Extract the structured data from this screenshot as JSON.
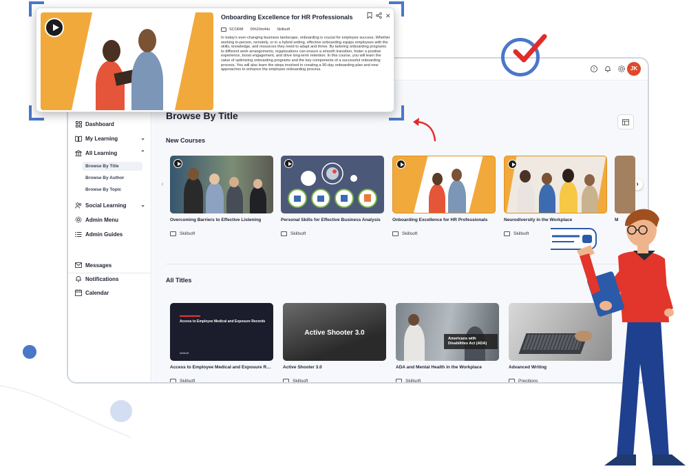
{
  "popup": {
    "title": "Onboarding Excellence for HR Professionals",
    "format": "SCORM",
    "duration": "00h20m44s",
    "provider": "Skillsoft",
    "description": "In today's ever-changing business landscape, onboarding is crucial for employee success. Whether working in-person, remotely, or in a hybrid setting, effective onboarding equips employees with the skills, knowledge, and resources they need to adapt and thrive. By tailoring onboarding programs to different work arrangements, organizations can ensure a smooth transition, foster a positive experience, boost engagement, and drive long-term retention. In this course, you will learn the value of optimizing onboarding programs and the key components of a successful onboarding process. You will also learn the steps involved in creating a 90-day onboarding plan and new approaches to enhance the employee onboarding process."
  },
  "topbar": {
    "avatar_initials": "JK"
  },
  "sidebar": {
    "items": [
      {
        "label": "Dashboard"
      },
      {
        "label": "My Learning"
      },
      {
        "label": "All Learning"
      },
      {
        "label": "Social Learning"
      },
      {
        "label": "Admin Menu"
      },
      {
        "label": "Admin Guides"
      }
    ],
    "sub_items": [
      {
        "label": "Browse By Title"
      },
      {
        "label": "Browse By Author"
      },
      {
        "label": "Browse By Topic"
      }
    ],
    "bottom_items": [
      {
        "label": "Messages"
      },
      {
        "label": "Notifications"
      },
      {
        "label": "Calendar"
      }
    ]
  },
  "main": {
    "page_title": "Browse By Title",
    "new_courses_title": "New Courses",
    "all_titles_title": "All Titles",
    "new_courses": [
      {
        "title": "Overcoming Barriers to Effective Listening",
        "provider": "Skillsoft"
      },
      {
        "title": "Personal Skills for Effective Business Analysis",
        "provider": "Skillsoft"
      },
      {
        "title": "Onboarding Excellence for HR Professionals",
        "provider": "Skillsoft"
      },
      {
        "title": "Neurodiversity in the Workplace",
        "provider": "Skillsoft"
      },
      {
        "title": "M",
        "provider": ""
      }
    ],
    "all_titles": [
      {
        "title": "Access to Employee Medical and Exposure Records",
        "provider": "Skillsoft",
        "thumb_text": "Access to Employee Medical and Exposure Records",
        "thumb_brand": "skillsoft"
      },
      {
        "title": "Active Shooter 3.0",
        "provider": "Skillsoft",
        "thumb_text": "Active Shooter 3.0"
      },
      {
        "title": "ADA and Mental Health in the Workplace",
        "provider": "Skillsoft",
        "thumb_text": "Americans with Disabilities Act (ADA)"
      },
      {
        "title": "Advanced Writing",
        "provider": "Precitions"
      }
    ]
  },
  "colors": {
    "accent_blue": "#4a77c8",
    "orange": "#f2a93b",
    "check_red": "#e22b2b",
    "avatar_red": "#e0472b"
  }
}
